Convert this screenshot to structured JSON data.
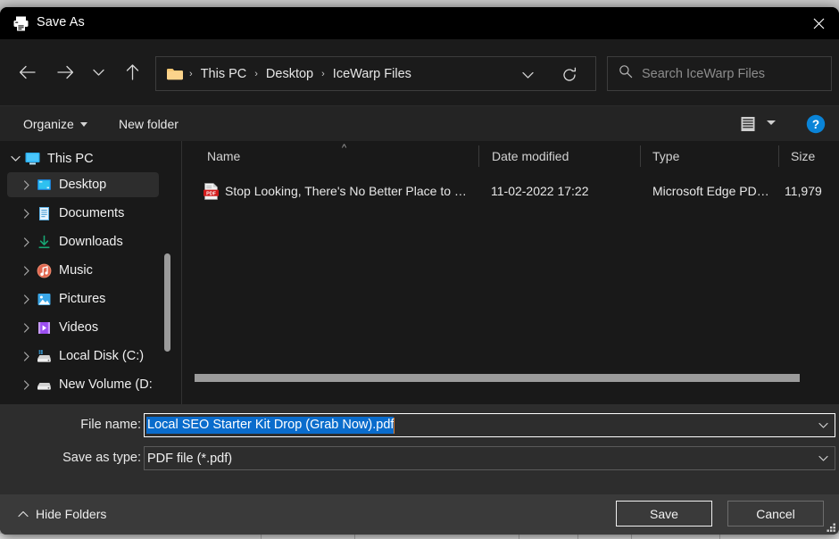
{
  "window": {
    "title": "Save As",
    "icon": "printer-icon",
    "close_label": "✕"
  },
  "nav": {
    "back": "back-arrow-icon",
    "forward": "forward-arrow-icon",
    "recent": "chevron-down-icon",
    "up": "up-arrow-icon",
    "refresh": "refresh-icon",
    "dropdown": "chevron-down-icon"
  },
  "breadcrumb": {
    "folder_icon": "folder-icon",
    "separator": "›",
    "items": [
      "This PC",
      "Desktop",
      "IceWarp Files"
    ]
  },
  "search": {
    "placeholder": "Search IceWarp Files",
    "value": "",
    "icon": "search-icon"
  },
  "commandbar": {
    "organize_label": "Organize",
    "new_folder_label": "New folder",
    "view_icon": "list-view-icon",
    "help_icon": "help-icon",
    "help_glyph": "?"
  },
  "sidebar": {
    "items": [
      {
        "label": "This PC",
        "icon": "monitor-icon",
        "level": 0,
        "expanded": true,
        "selected": false
      },
      {
        "label": "Desktop",
        "icon": "desktop-icon",
        "level": 1,
        "expanded": false,
        "selected": true
      },
      {
        "label": "Documents",
        "icon": "documents-icon",
        "level": 1,
        "expanded": false,
        "selected": false
      },
      {
        "label": "Downloads",
        "icon": "downloads-icon",
        "level": 1,
        "expanded": false,
        "selected": false
      },
      {
        "label": "Music",
        "icon": "music-icon",
        "level": 1,
        "expanded": false,
        "selected": false
      },
      {
        "label": "Pictures",
        "icon": "pictures-icon",
        "level": 1,
        "expanded": false,
        "selected": false
      },
      {
        "label": "Videos",
        "icon": "videos-icon",
        "level": 1,
        "expanded": false,
        "selected": false
      },
      {
        "label": "Local Disk (C:)",
        "icon": "harddisk-icon",
        "level": 1,
        "expanded": false,
        "selected": false
      },
      {
        "label": "New Volume (D:",
        "icon": "drive-icon",
        "level": 1,
        "expanded": false,
        "selected": false
      }
    ]
  },
  "filelist": {
    "columns": [
      {
        "label": "Name",
        "sorted": true
      },
      {
        "label": "Date modified",
        "sorted": false
      },
      {
        "label": "Type",
        "sorted": false
      },
      {
        "label": "Size",
        "sorted": false
      }
    ],
    "sort_indicator": "^",
    "rows": [
      {
        "icon": "pdf-file-icon",
        "icon_label": "PDF",
        "name": "Stop Looking, There's No Better Place to …",
        "date_modified": "11-02-2022 17:22",
        "type": "Microsoft Edge PD…",
        "size": "11,979"
      }
    ]
  },
  "form": {
    "filename_label": "File name:",
    "filename_value": "Local SEO Starter Kit Drop (Grab Now).pdf",
    "filename_selected": true,
    "filetype_label": "Save as type:",
    "filetype_value": "PDF file (*.pdf)",
    "dropdown_icon": "chevron-down-icon"
  },
  "footer": {
    "hide_folders_label": "Hide Folders",
    "hide_folders_chevron": "chevron-up-icon",
    "save_label": "Save",
    "cancel_label": "Cancel",
    "resize_grip": "resize-grip-icon"
  },
  "colors": {
    "selection_blue": "#0a6ccc",
    "caret_orange": "#e07b2a",
    "help_blue": "#0a84d8",
    "pdf_red": "#d21b1b",
    "title_bar": "#000000",
    "dialog_bg": "#202020",
    "form_bg": "#2d2d2d",
    "footer_bg": "#3a3a3a"
  }
}
